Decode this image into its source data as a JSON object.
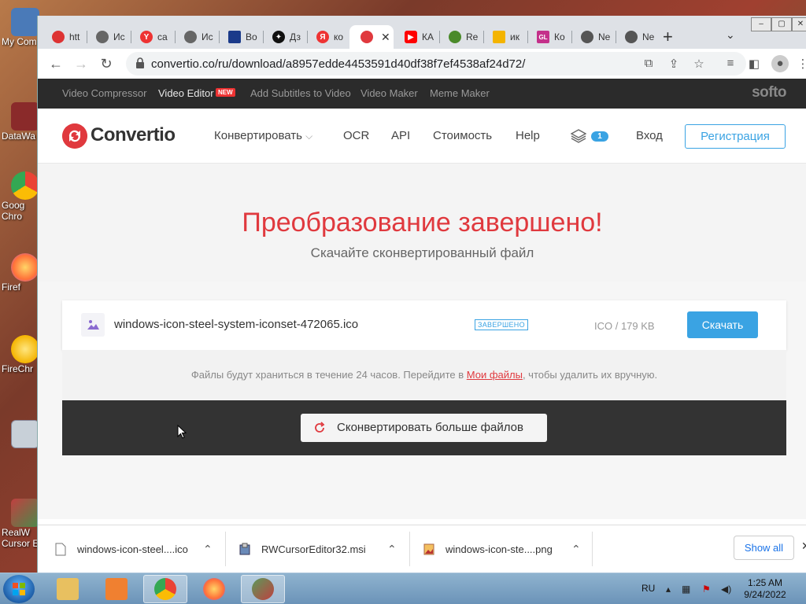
{
  "desktop": {
    "icons": [
      {
        "label": "My Com",
        "color": "#4a7ab8"
      },
      {
        "label": "DataWa",
        "color": "#8a2a2a"
      },
      {
        "label": "Goog\nChro",
        "color": "#34a853"
      },
      {
        "label": "Firef",
        "color": "#ff7139"
      },
      {
        "label": "FireChr",
        "color": "#f4b400"
      },
      {
        "label": "",
        "color": "#c8d0d8"
      },
      {
        "label": "RealW\nCursor E",
        "color": "#c04040"
      }
    ]
  },
  "browser": {
    "tabs": [
      {
        "label": "htt",
        "fav_color": "#d33"
      },
      {
        "label": "Ис",
        "fav_color": "#666"
      },
      {
        "label": "са",
        "fav_color": "#e33",
        "fav_char": "Y"
      },
      {
        "label": "Ис",
        "fav_color": "#666"
      },
      {
        "label": "Во",
        "fav_color": "#1a3a8a"
      },
      {
        "label": "Дз",
        "fav_color": "#111"
      },
      {
        "label": "ко",
        "fav_color": "#e33",
        "fav_char": "Я"
      },
      {
        "label": "",
        "fav_color": "#e0393e",
        "active": true
      },
      {
        "label": "КА",
        "fav_color": "#f00"
      },
      {
        "label": "Re",
        "fav_color": "#4a8a2a"
      },
      {
        "label": "ик",
        "fav_color": "#f4b400"
      },
      {
        "label": "Ко",
        "fav_color": "#c4308a",
        "fav_char": "GL"
      },
      {
        "label": "Ne",
        "fav_color": "#555"
      },
      {
        "label": "Ne",
        "fav_color": "#555"
      }
    ],
    "new_tab": "+",
    "url": "convertio.co/ru/download/a8957edde4453591d40df38f7ef4538af24d72/"
  },
  "site": {
    "top_links": [
      {
        "label": "Video Compressor",
        "active": false
      },
      {
        "label": "Video Editor",
        "active": true
      },
      {
        "label": "Add Subtitles to Video",
        "active": false
      },
      {
        "label": "Video Maker",
        "active": false
      },
      {
        "label": "Meme Maker",
        "active": false
      }
    ],
    "new_badge": "NEW",
    "softo": "softo",
    "logo_text": "Convertio",
    "nav": {
      "convert": "Конвертировать",
      "ocr": "OCR",
      "api": "API",
      "pricing": "Стоимость",
      "help": "Help",
      "layers_count": "1",
      "login": "Вход",
      "signup": "Регистрация"
    },
    "hero": {
      "title": "Преобразование завершено!",
      "subtitle": "Скачайте сконвертированный файл"
    },
    "file": {
      "name": "windows-icon-steel-system-iconset-472065.ico",
      "status": "ЗАВЕРШЕНО",
      "info": "ICO / 179 KB",
      "download": "Скачать"
    },
    "note": {
      "before": "Файлы будут храниться в течение 24 часов. Перейдите в ",
      "link": "Мои файлы",
      "after": ", чтобы удалить их вручную."
    },
    "convert_more": "Сконвертировать больше файлов",
    "colors": {
      "brand_red": "#e0393e",
      "accent_blue": "#3aa3e3"
    }
  },
  "downloads": {
    "items": [
      {
        "name": "windows-icon-steel....ico"
      },
      {
        "name": "RWCursorEditor32.msi"
      },
      {
        "name": "windows-icon-ste....png"
      }
    ],
    "show_all": "Show all"
  },
  "taskbar": {
    "lang": "RU",
    "time": "1:25 AM",
    "date": "9/24/2022"
  }
}
